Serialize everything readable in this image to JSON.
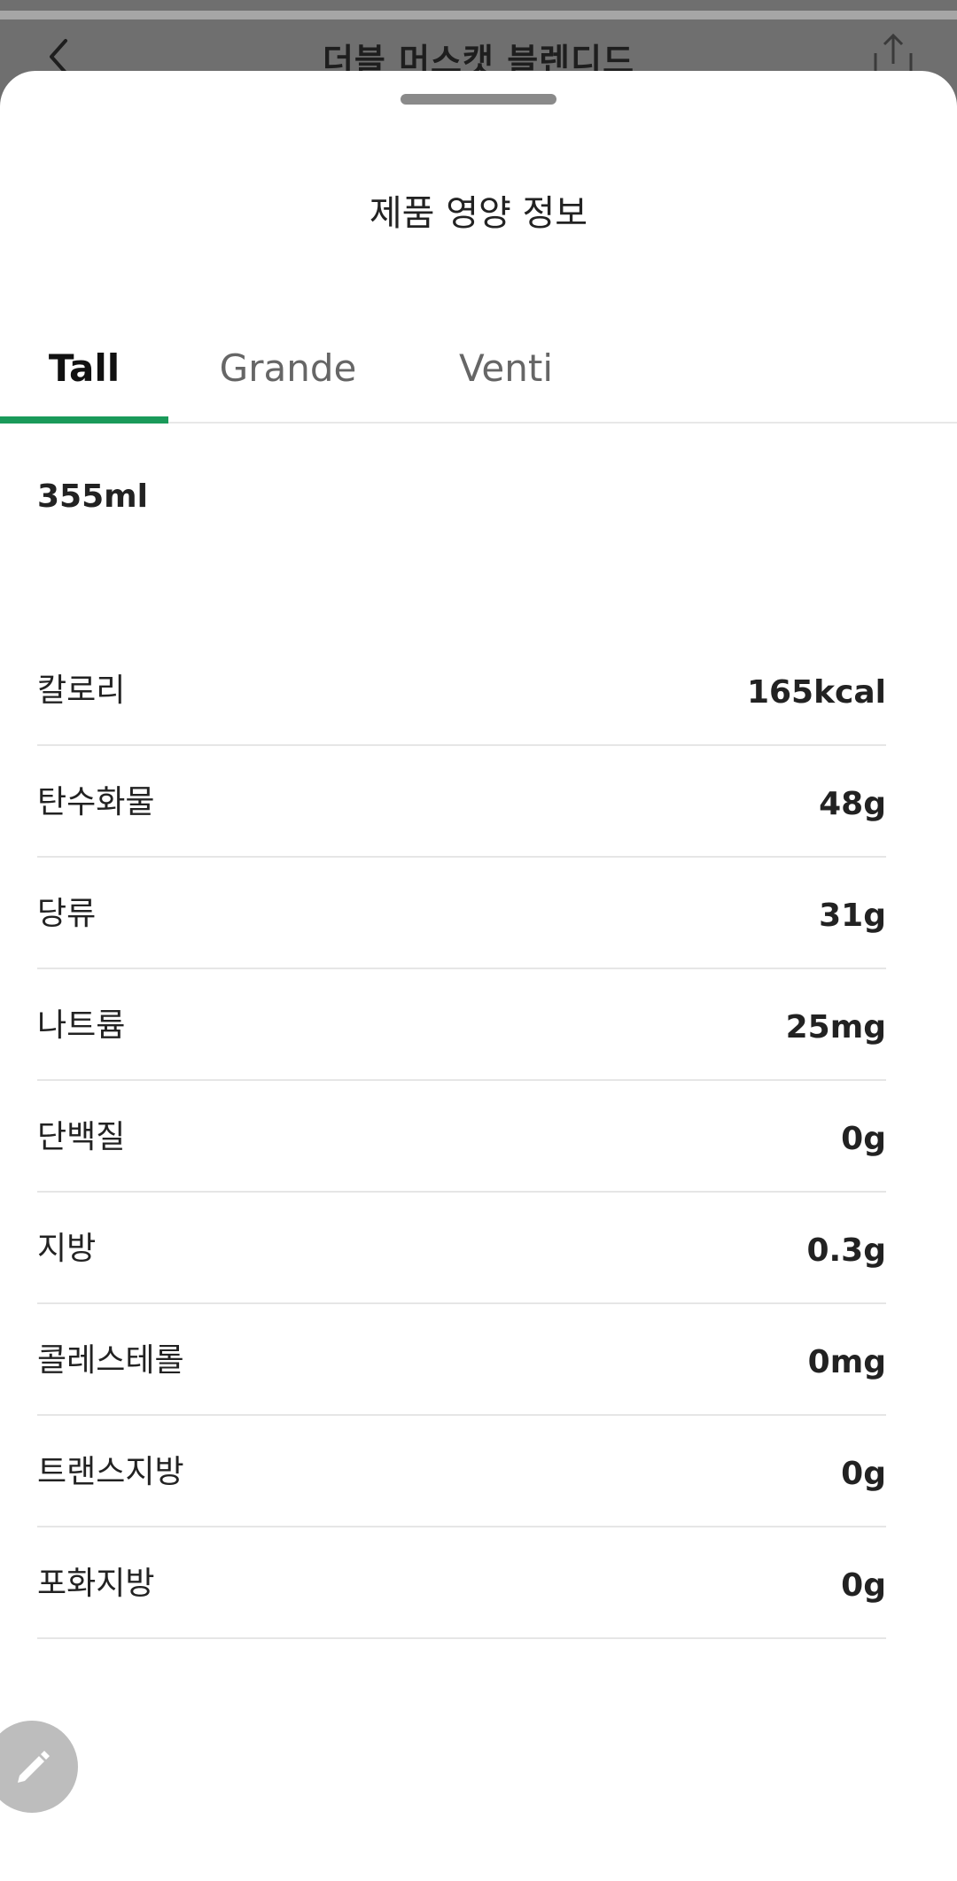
{
  "background": {
    "title": "더블 머스캣 블렌디드",
    "back_icon": "chevron-left-icon",
    "share_icon": "share-icon"
  },
  "sheet": {
    "title": "제품 영양 정보",
    "tabs": [
      {
        "label": "Tall",
        "active": true
      },
      {
        "label": "Grande",
        "active": false
      },
      {
        "label": "Venti",
        "active": false
      }
    ],
    "serving": "355ml",
    "nutrition": [
      {
        "label": "칼로리",
        "value": "165kcal"
      },
      {
        "label": "탄수화물",
        "value": "48g"
      },
      {
        "label": "당류",
        "value": "31g"
      },
      {
        "label": "나트륨",
        "value": "25mg"
      },
      {
        "label": "단백질",
        "value": "0g"
      },
      {
        "label": "지방",
        "value": "0.3g"
      },
      {
        "label": "콜레스테롤",
        "value": "0mg"
      },
      {
        "label": "트랜스지방",
        "value": "0g"
      },
      {
        "label": "포화지방",
        "value": "0g"
      }
    ]
  },
  "fab": {
    "icon": "pencil-icon"
  },
  "colors": {
    "accent": "#1a9a5a",
    "dim_overlay": "#6f6f6f"
  }
}
